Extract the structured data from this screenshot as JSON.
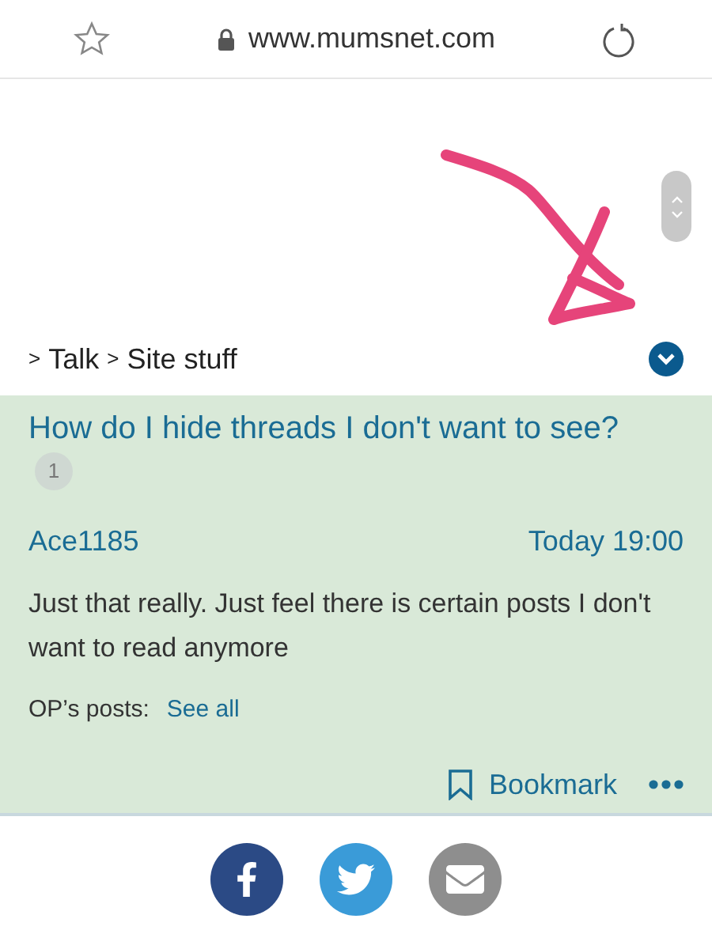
{
  "address_bar": {
    "url": "www.mumsnet.com"
  },
  "breadcrumb": [
    {
      "separator": ">",
      "label": "Talk"
    },
    {
      "separator": ">",
      "label": "Site stuff"
    }
  ],
  "thread": {
    "title": "How do I hide threads I don't want to see?",
    "count": "1",
    "post": {
      "author": "Ace1185",
      "time": "Today 19:00",
      "body": "Just that really. Just feel there is certain posts I don't want to read anymore",
      "op_label": "OP’s posts:",
      "op_link": "See all",
      "bookmark": "Bookmark"
    }
  },
  "share": [
    {
      "kind": "facebook",
      "color": "#2b4a85"
    },
    {
      "kind": "twitter",
      "color": "#3a9bd8"
    },
    {
      "kind": "mail",
      "color": "#8e8e8e"
    }
  ]
}
